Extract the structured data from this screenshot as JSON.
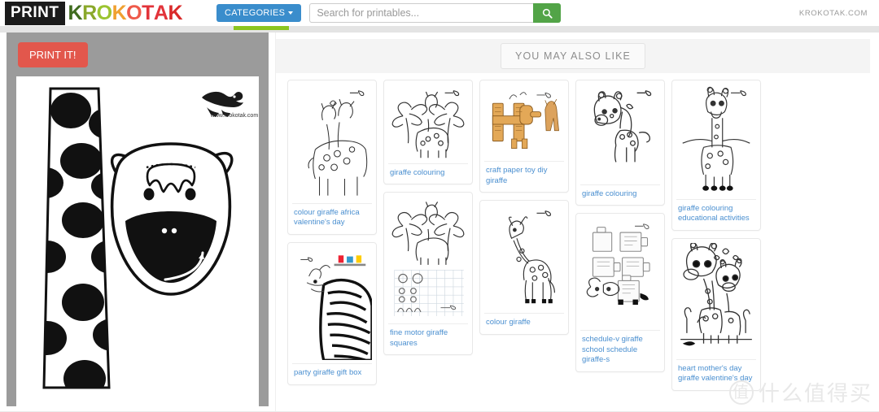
{
  "header": {
    "logo_print": "PRINT",
    "logo_word": "KROKOTAK",
    "logo_letters": [
      {
        "ch": "K",
        "color": "#3f6b1e"
      },
      {
        "ch": "R",
        "color": "#8aa82a"
      },
      {
        "ch": "O",
        "color": "#9bc430"
      },
      {
        "ch": "K",
        "color": "#f0a030"
      },
      {
        "ch": "O",
        "color": "#ef5a4a"
      },
      {
        "ch": "T",
        "color": "#e2333a"
      },
      {
        "ch": "A",
        "color": "#e2333a"
      },
      {
        "ch": "K",
        "color": "#d92a2a"
      }
    ],
    "categories_label": "CATEGORIES",
    "search_placeholder": "Search for printables...",
    "search_value": "",
    "search_icon": "search-icon",
    "site_url": "KROKOTAK.COM",
    "accent_blue": "#3a8dcc",
    "accent_green": "#52a447",
    "tab_green": "#8bc520"
  },
  "preview": {
    "print_button_label": "PRINT IT!",
    "print_button_color": "#e2574c",
    "watermark_text": "www.krokotak.com",
    "artwork_name": "giraffe-mask-and-neck-strip"
  },
  "related": {
    "section_label": "YOU MAY ALSO LIKE",
    "columns": [
      [
        {
          "title": "colour giraffe africa valentine's day",
          "art": "two-giraffes"
        },
        {
          "title": "party giraffe gift box",
          "art": "zebra-stripes"
        }
      ],
      [
        {
          "title": "giraffe colouring",
          "art": "giraffe-palms"
        }
      ],
      [
        {
          "title": "fine motor giraffe squares",
          "art": "giraffe-grid"
        }
      ],
      [
        {
          "title": "craft paper toy diy giraffe",
          "art": "paper-toy-giraffe"
        },
        {
          "title": "colour giraffe",
          "art": "standing-giraffe"
        }
      ],
      [
        {
          "title": "giraffe colouring",
          "art": "cartoon-giraffe"
        },
        {
          "title": "schedule-v giraffe school schedule giraffe-s",
          "art": "schedule-cards"
        }
      ],
      [
        {
          "title": "giraffe colouring educational activities",
          "art": "tall-giraffe"
        },
        {
          "title": "heart mother's day giraffe valentine's day",
          "art": "two-giraffes-hearts"
        }
      ]
    ]
  },
  "watermark": {
    "badge": "值",
    "text": "什么值得买"
  }
}
